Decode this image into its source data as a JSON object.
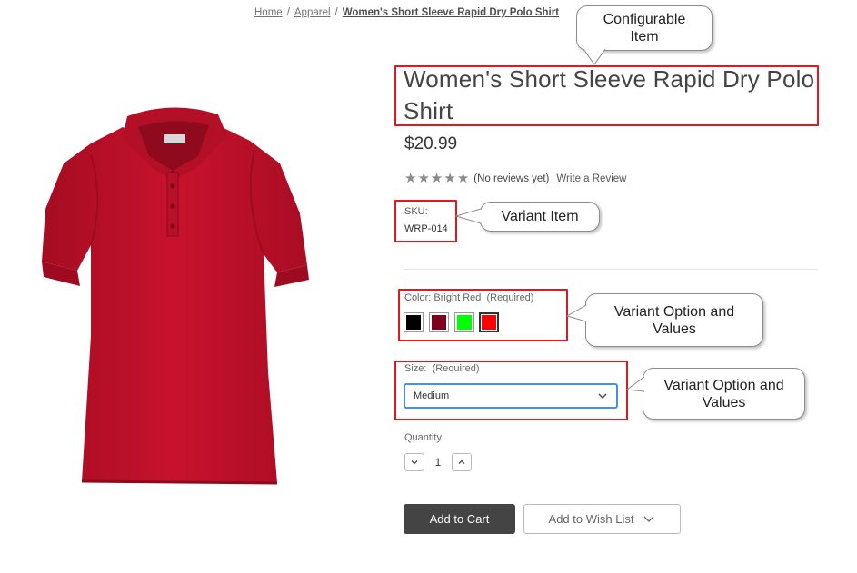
{
  "breadcrumb": {
    "items": [
      "Home",
      "Apparel",
      "Women's Short Sleeve Rapid Dry Polo Shirt"
    ],
    "separator": "/"
  },
  "product": {
    "title": "Women's Short Sleeve Rapid Dry Polo Shirt",
    "price": "$20.99",
    "rating": {
      "stars_filled": 0,
      "stars_total": 5,
      "reviews_text": "(No reviews yet)",
      "write_review_label": "Write a Review"
    },
    "sku": {
      "label": "SKU:",
      "value": "WRP-014"
    },
    "color": {
      "label": "Color: Bright Red",
      "required": "(Required)",
      "swatches": [
        {
          "color": "#000000",
          "selected": false
        },
        {
          "color": "#800020",
          "selected": false
        },
        {
          "color": "#00ff00",
          "selected": false
        },
        {
          "color": "#ff0000",
          "selected": true
        }
      ]
    },
    "size": {
      "label": "Size:",
      "required": "(Required)",
      "selected": "Medium"
    },
    "quantity": {
      "label": "Quantity:",
      "value": "1"
    },
    "buttons": {
      "add_to_cart": "Add to Cart",
      "wishlist": "Add to Wish List"
    },
    "image": {
      "shirt_color": "#c0102a"
    }
  },
  "annotations": {
    "configurable_item": "Configurable Item",
    "variant_item": "Variant Item",
    "variant_option_values_1": "Variant Option and Values",
    "variant_option_values_2": "Variant Option and Values",
    "highlight_color": "#e0191f"
  }
}
